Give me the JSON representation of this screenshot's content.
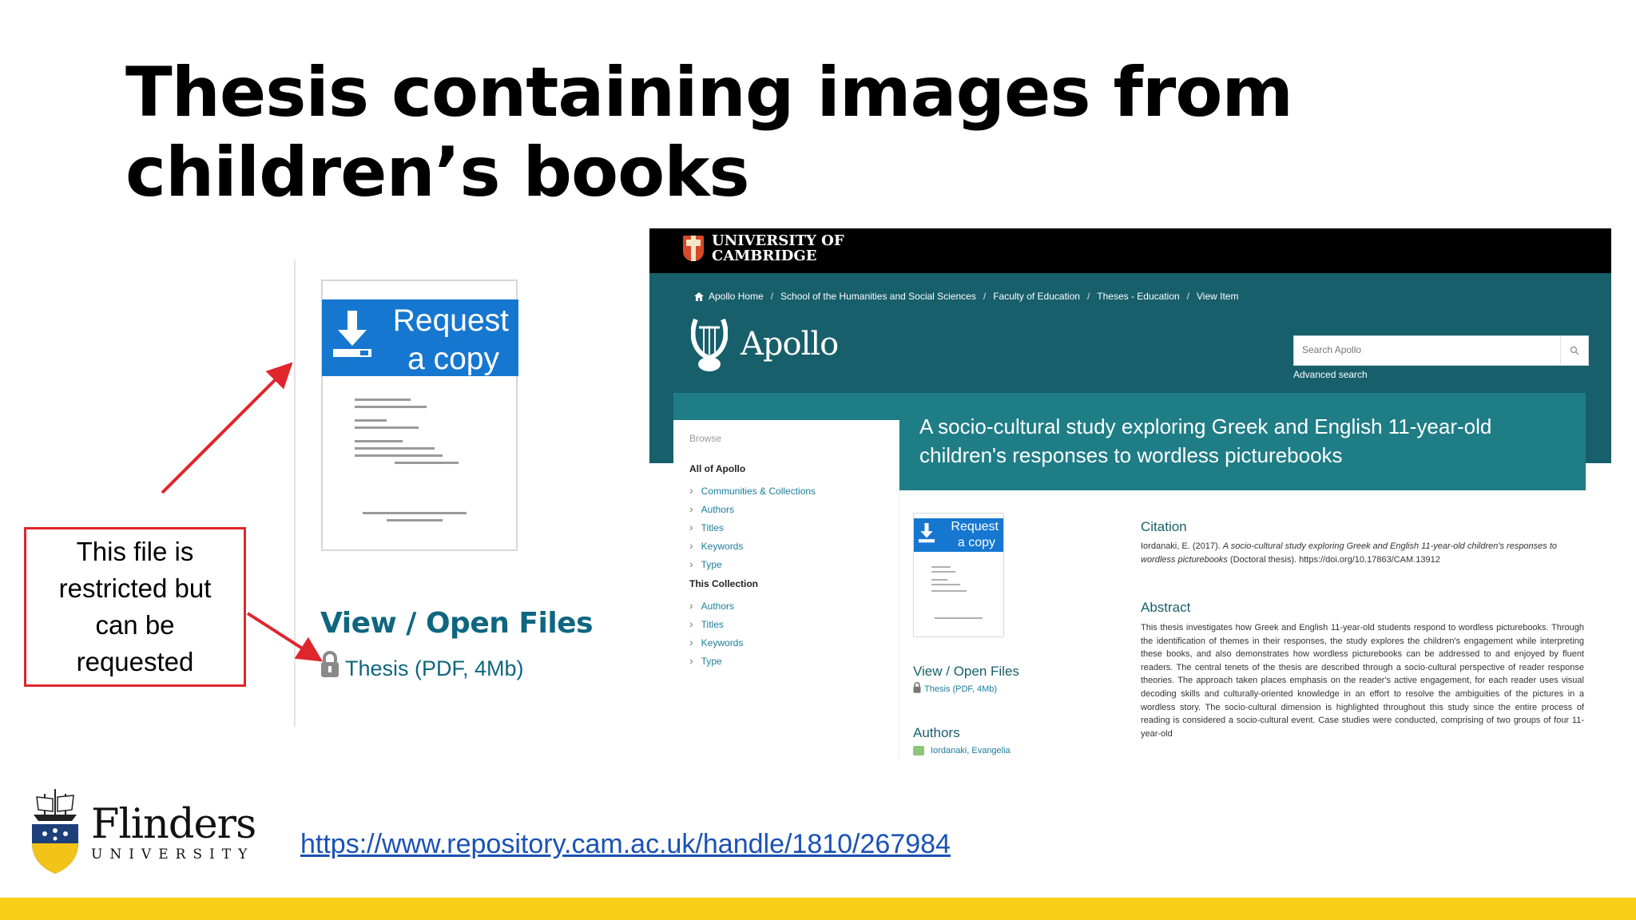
{
  "slide": {
    "title_line1": "Thesis containing images from",
    "title_line2": "children’s books",
    "callout": "This file is restricted but can be requested",
    "url": "https://www.repository.cam.ac.uk/handle/1810/267984"
  },
  "zoom": {
    "request_line1": "Request",
    "request_line2": "a copy",
    "view_heading": "View / Open Files",
    "thesis_link": "Thesis (PDF, 4Mb)"
  },
  "cambridge": {
    "logo_line1": "UNIVERSITY OF",
    "logo_line2": "CAMBRIDGE",
    "breadcrumb": [
      "Apollo Home",
      "School of the Humanities and Social Sciences",
      "Faculty of Education",
      "Theses - Education",
      "View Item"
    ],
    "site_name": "Apollo",
    "search_placeholder": "Search Apollo",
    "advanced_search": "Advanced search",
    "item_title": "A socio-cultural study exploring Greek and English 11-year-old children's responses to wordless picturebooks",
    "sidebar": {
      "browse": "Browse",
      "all_heading": "All of Apollo",
      "all_items": [
        "Communities & Collections",
        "Authors",
        "Titles",
        "Keywords",
        "Type"
      ],
      "collection_heading": "This Collection",
      "collection_items": [
        "Authors",
        "Titles",
        "Keywords",
        "Type"
      ]
    },
    "thumb_request_line1": "Request",
    "thumb_request_line2": "a copy",
    "view_heading": "View / Open Files",
    "thesis_link": "Thesis (PDF, 4Mb)",
    "authors_heading": "Authors",
    "author_name": "Iordanaki, Evangelia",
    "citation_heading": "Citation",
    "citation_prefix": "Iordanaki, E. (2017).",
    "citation_title": "A socio-cultural study exploring Greek and English 11-year-old children's responses to wordless picturebooks",
    "citation_suffix": "(Doctoral thesis). https://doi.org/10.17863/CAM.13912",
    "abstract_heading": "Abstract",
    "abstract_text": "This thesis investigates how Greek and English 11-year-old students respond to wordless picturebooks. Through the identification of themes in their responses, the study explores the children's engagement while interpreting these books, and also demonstrates how wordless picturebooks can be addressed to and enjoyed by fluent readers. The central tenets of the thesis are described through a socio-cultural perspective of reader response theories. The approach taken places emphasis on the reader's active engagement, for each reader uses visual decoding skills and culturally-oriented knowledge in an effort to resolve the ambiguities of the pictures in a wordless story. The socio-cultural dimension is highlighted throughout this study since the entire process of reading is considered a socio-cultural event. Case studies were conducted, comprising of two groups of four 11-year-old"
  },
  "footer": {
    "brand": "Flinders",
    "brand_sub": "UNIVERSITY"
  },
  "colors": {
    "teal": "#175f6b",
    "request_blue": "#1677d0",
    "callout_red": "#e0262d",
    "footer_yellow": "#f7cf16"
  }
}
